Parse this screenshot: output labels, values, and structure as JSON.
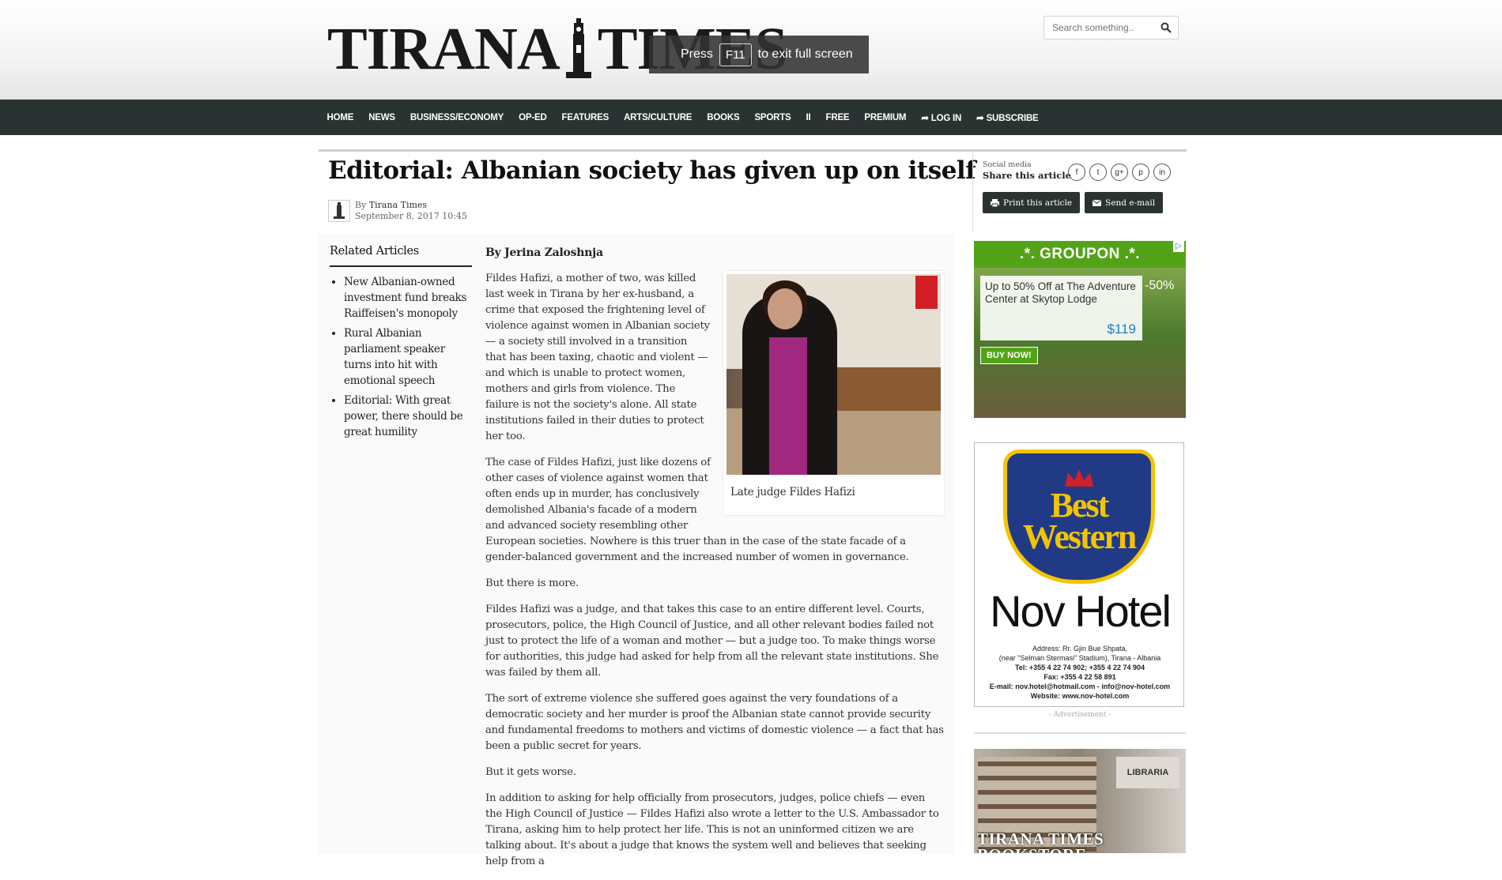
{
  "site": {
    "logo_left": "TIRANA",
    "logo_right": "TIMES",
    "search_placeholder": "Search something..",
    "fullscreen_notice": {
      "before": "Press",
      "key": "F11",
      "after": "to exit full screen"
    }
  },
  "nav": {
    "items": [
      "HOME",
      "NEWS",
      "BUSINESS/ECONOMY",
      "OP-ED",
      "FEATURES",
      "ARTS/CULTURE",
      "BOOKS",
      "SPORTS",
      "II",
      "FREE",
      "PREMIUM",
      "➦ LOG IN",
      "➦ SUBSCRIBE"
    ]
  },
  "article": {
    "title": "Editorial: Albanian society has given up on itself",
    "by_prefix": "By",
    "by_name": "Tirana Times",
    "date": "September 8, 2017 10:45",
    "author_line": "By Jerina Zaloshnja",
    "figure_caption": "Late judge Fildes Hafizi",
    "paragraphs": [
      "Fildes Hafizi, a mother of two, was killed last week in Tirana by her ex-husband, a crime that exposed the frightening level of violence against women in Albanian society — a society still involved in a transition that has been taxing, chaotic and violent — and which is unable to protect women, mothers and girls from violence. The failure is not the society's alone. All state institutions failed in their duties to protect her too.",
      "The case of Fildes Hafizi, just like dozens of other cases of violence against women that often ends up in murder, has conclusively demolished Albania's facade of a modern and advanced society resembling other European societies. Nowhere is this truer than in the case of the state facade of a gender-balanced government and the increased number of women in governance.",
      "But there is more.",
      "Fildes Hafizi was a judge, and that takes this case to an entire different level. Courts, prosecutors, police, the High Council of Justice, and all other relevant bodies failed not just to protect the life of a woman and mother — but a judge too. To make things worse for authorities, this judge had asked for help from all the relevant state institutions.  She was failed by them all.",
      "The sort of extreme violence she suffered goes against the very foundations of a democratic society and her murder is proof the Albanian state cannot provide security and fundamental freedoms to mothers and victims of domestic violence — a fact that has been a public secret for years.",
      "But it gets worse.",
      "In addition to asking for help officially from prosecutors, judges, police chiefs — even the High Council of Justice — Fildes Hafizi also wrote a letter to the U.S. Ambassador to Tirana, asking him to help protect her life. This is not an uninformed citizen we are talking about. It's about a judge that knows the system well and believes that seeking help from a"
    ]
  },
  "share": {
    "label_small": "Social media",
    "label": "Share this article",
    "icons": [
      "f",
      "t",
      "g+",
      "p",
      "in"
    ],
    "print_label": "Print this article",
    "email_label": "Send e-mail"
  },
  "related": {
    "heading": "Related Articles",
    "items": [
      "New Albanian-owned investment fund breaks Raiffeisen's monopoly",
      "Rural Albanian parliament speaker turns into hit with emotional speech",
      "Editorial: With great power, there should be great humility"
    ]
  },
  "ads": {
    "groupon": {
      "brand": ".*. GROUPON .*.",
      "offer": "Up to 50% Off at The Adventure Center at Skytop Lodge",
      "price": "$119",
      "discount": "-50%",
      "cta": "BUY NOW!"
    },
    "bestwestern": {
      "brand_line1": "Best",
      "brand_line2": "Western",
      "hotel": "Nov Hotel",
      "address_lines": [
        "Address: Rr. Gjin Bue Shpata,",
        "(near \"Selman Stermasi\" Stadium), Tirana - Albania",
        "Tel: +355 4 22 74 902; +355 4 22 74 904",
        "Fax: +355 4 22 58 891",
        "E-mail: nov.hotel@hotmail.com - info@nov-hotel.com",
        "Website: www.nov-hotel.com"
      ],
      "advert_label": "- Advertisement -"
    },
    "bookstore": {
      "text_line1": "TIRANA TIMES",
      "text_line2": "BOOKSTORE",
      "sign": "LIBRARIA"
    }
  },
  "colors": {
    "nav_bg": "#2b3332",
    "groupon_green": "#53a318",
    "bw_blue": "#203a86",
    "bw_gold": "#f4c400"
  }
}
